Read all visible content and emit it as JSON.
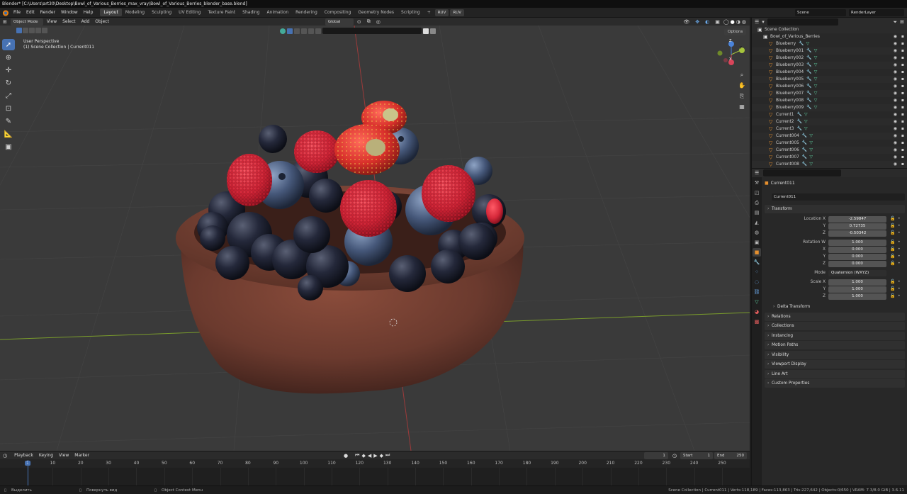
{
  "window": {
    "title": "Blender* [C:\\Users\\art30\\Desktop\\Bowl_of_Various_Berries_max_vray\\Bowl_of_Various_Berries_blender_base.blend]"
  },
  "menu": [
    "File",
    "Edit",
    "Render",
    "Window",
    "Help"
  ],
  "workspaces": [
    "Layout",
    "Modeling",
    "Sculpting",
    "UV Editing",
    "Texture Paint",
    "Shading",
    "Animation",
    "Rendering",
    "Compositing",
    "Geometry Nodes",
    "Scripting"
  ],
  "workspace_extra": {
    "add": "+",
    "ruv1": "RUV",
    "ruv2": "RUV"
  },
  "scene": {
    "scene_label": "Scene",
    "render_layer": "RenderLayer"
  },
  "viewport": {
    "mode": "Object Mode",
    "menus": [
      "View",
      "Select",
      "Add",
      "Object"
    ],
    "orientation": "Global",
    "options_label": "Options",
    "overlay_title": "User Perspective",
    "overlay_sub": "(1) Scene Collection | Current011"
  },
  "gizmo": {
    "x": "X",
    "y": "Y",
    "z": "Z"
  },
  "outliner": {
    "root": "Scene Collection",
    "collection": "Bowl_of_Various_Berries",
    "items": [
      "Blueberry",
      "Blueberry001",
      "Blueberry002",
      "Blueberry003",
      "Blueberry004",
      "Blueberry005",
      "Blueberry006",
      "Blueberry007",
      "Blueberry008",
      "Blueberry009",
      "Current1",
      "Current2",
      "Current3",
      "Current004",
      "Current005",
      "Current006",
      "Current007",
      "Current008"
    ]
  },
  "properties": {
    "object_name": "Current011",
    "data_name": "Current011",
    "transform_title": "Transform",
    "location_label": "Location X",
    "y_label": "Y",
    "z_label": "Z",
    "w_label": "Rotation W",
    "x_label": "X",
    "mode_label": "Mode",
    "scale_label": "Scale X",
    "location": [
      "-2.59847",
      "0.72735",
      "-0.50342"
    ],
    "rotation": [
      "1.000",
      "0.000",
      "0.000",
      "0.000"
    ],
    "mode": "Quaternion (WXYZ)",
    "scale": [
      "1.000",
      "1.000",
      "1.000"
    ],
    "panels": [
      "Delta Transform",
      "Relations",
      "Collections",
      "Instancing",
      "Motion Paths",
      "Visibility",
      "Viewport Display",
      "Line Art",
      "Custom Properties"
    ]
  },
  "timeline": {
    "menus": [
      "Playback",
      "Keying",
      "View",
      "Marker"
    ],
    "current_frame": "1",
    "start_label": "Start",
    "start": "1",
    "end_label": "End",
    "end": "250",
    "ticks": [
      "1",
      "10",
      "20",
      "30",
      "40",
      "50",
      "60",
      "70",
      "80",
      "90",
      "100",
      "110",
      "120",
      "130",
      "140",
      "150",
      "160",
      "170",
      "180",
      "190",
      "200",
      "210",
      "220",
      "230",
      "240",
      "250"
    ]
  },
  "status": {
    "select": "Выделить",
    "rotate": "Повернуть вид",
    "context": "Object Context Menu",
    "stats": "Scene Collection | Current011 | Verts:118,189 | Faces:113,863 | Tris:227,642 | Objects:0/650 | VRAM: 7.3/8.0 GiB | 3.6.11"
  },
  "colors": {
    "accent": "#4772b3",
    "bowl": "#6b3a2e",
    "raspberry": "#d6283a",
    "blueberry": "#46587a",
    "currant": "#24283a"
  }
}
